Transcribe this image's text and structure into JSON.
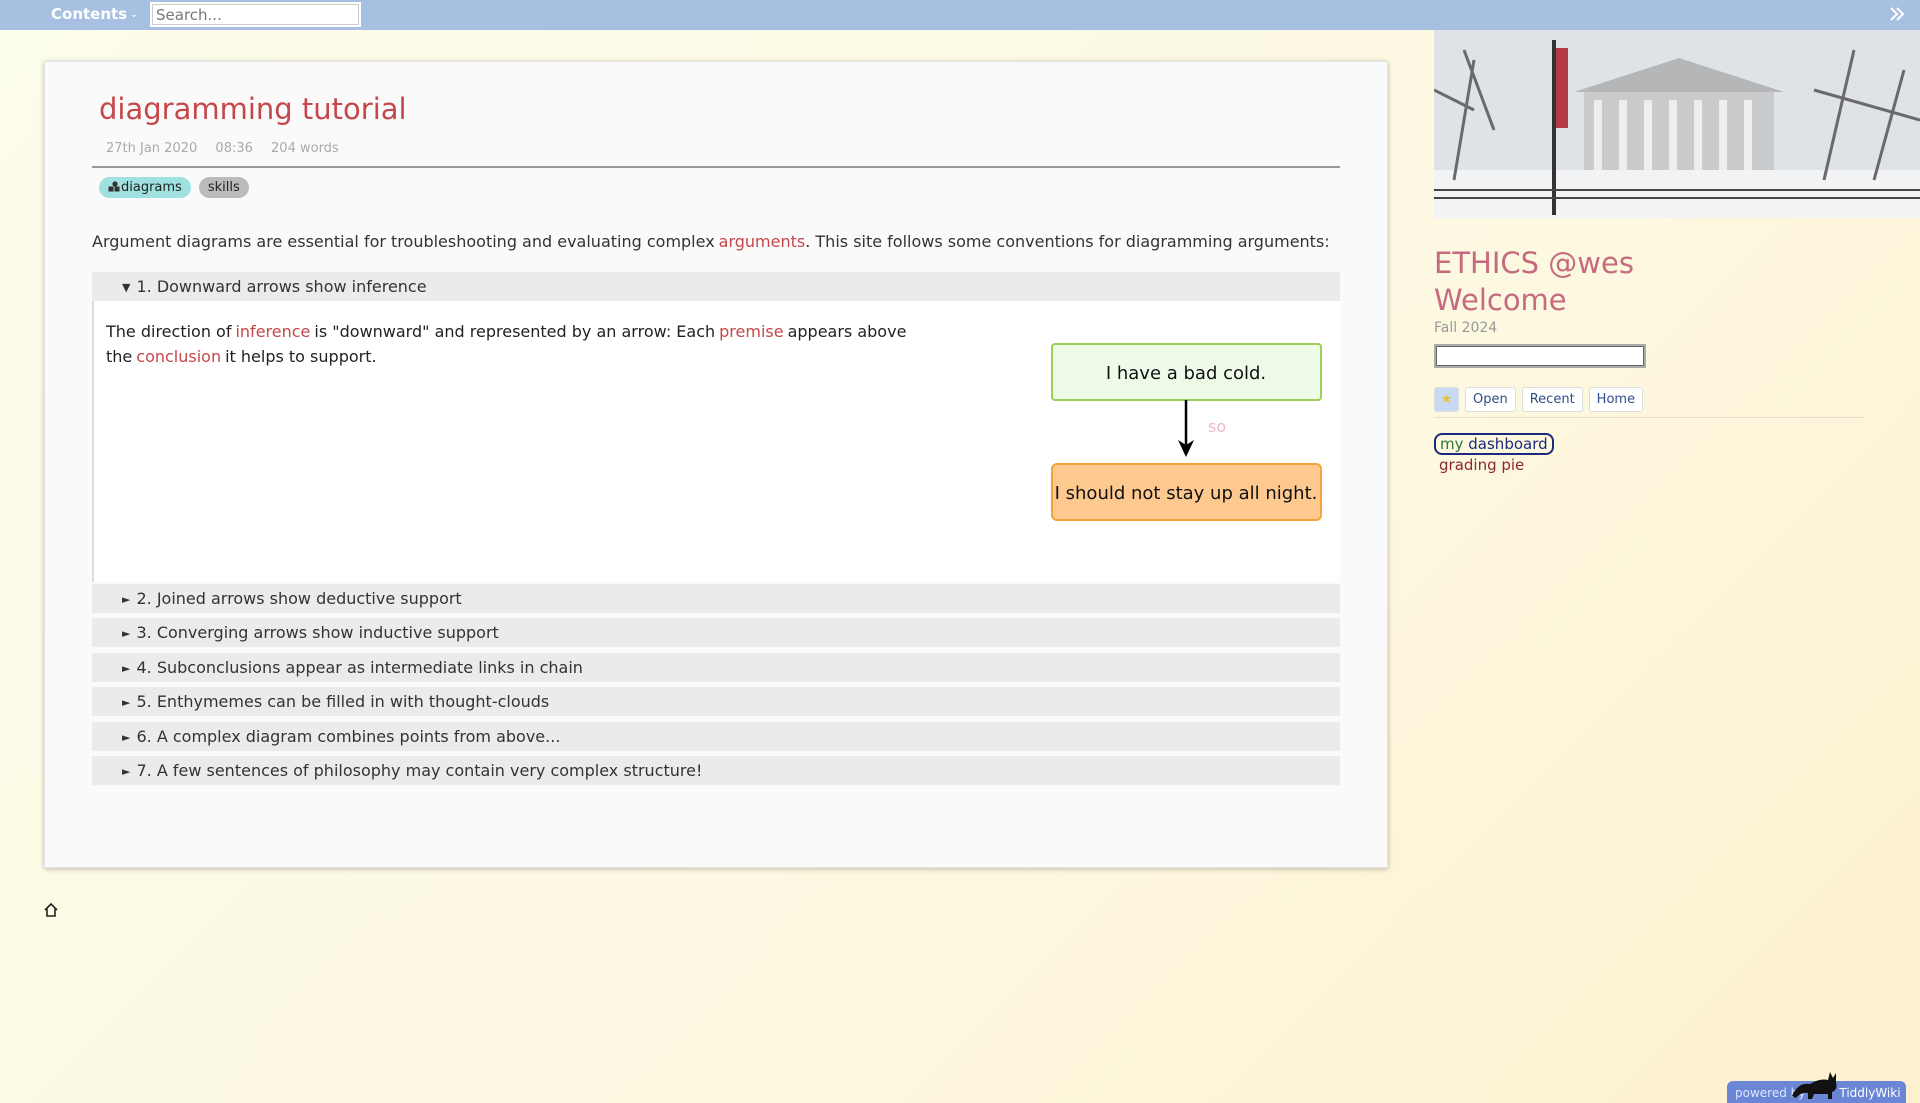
{
  "topbar": {
    "contents_label": "Contents",
    "search_placeholder": "Search..."
  },
  "tiddler": {
    "title": "diagramming tutorial",
    "date": "27th Jan 2020",
    "time": "08:36",
    "words": "204 words",
    "tags": [
      "diagrams",
      "skills"
    ],
    "intro_before": "Argument diagrams are essential for troubleshooting and evaluating complex",
    "intro_link": "arguments",
    "intro_after": ". This site follows some conventions for diagramming arguments:",
    "sections": [
      {
        "label": "1. Downward arrows show inference",
        "open": true,
        "text_1": "The direction of",
        "link_1": "inference",
        "text_2": "is \"downward\" and represented by an arrow: Each",
        "link_2": "premise",
        "text_3": "appears above the",
        "link_3": "conclusion",
        "text_4": "it helps to support.",
        "diagram": {
          "premise": "I have a bad cold.",
          "connector": "so",
          "conclusion": "I should not stay up all night."
        }
      },
      {
        "label": "2. Joined arrows show deductive support"
      },
      {
        "label": "3. Converging arrows show inductive support"
      },
      {
        "label": "4. Subconclusions appear as intermediate links in chain"
      },
      {
        "label": "5. Enthymemes can be filled in with thought-clouds"
      },
      {
        "label": "6. A complex diagram combines points from above..."
      },
      {
        "label": "7. A few sentences of philosophy may contain very complex structure!"
      }
    ]
  },
  "sidebar": {
    "title_line1": "ETHICS @wes",
    "title_line2": "Welcome",
    "subtitle": "Fall 2024",
    "tabs": [
      "Open",
      "Recent",
      "Home"
    ],
    "star_glyph": "★",
    "dashboard_link_1": "my",
    "dashboard_link_2": "dashboard",
    "pie_link": "grading pie"
  },
  "footer": {
    "powered_by": "powered by",
    "tiddlywiki": "TiddlyWiki"
  },
  "colors": {
    "topbar": "#a7bfe0",
    "title": "#c5474a",
    "premise_fill": "#eefbe8",
    "premise_stroke": "#9bd058",
    "conclusion_fill": "#fdc98f",
    "conclusion_stroke": "#f5a23a",
    "connector_text": "#f0b8c8",
    "site_title": "#c66a7f"
  }
}
